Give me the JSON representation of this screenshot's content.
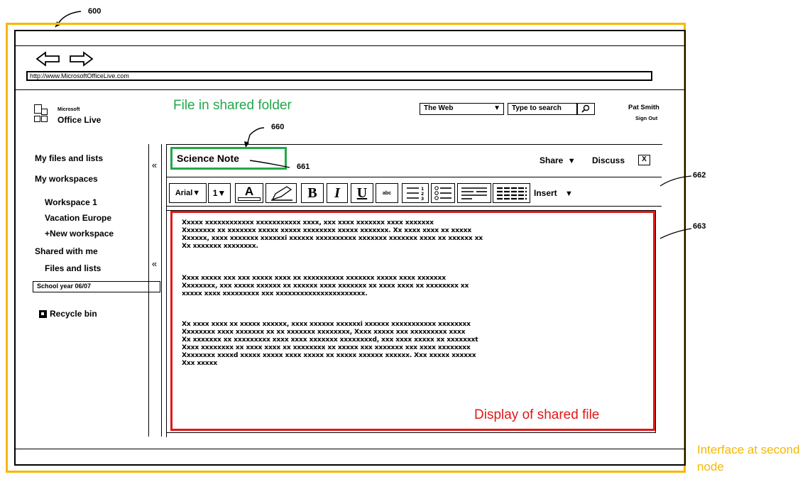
{
  "figure": {
    "ref_600": "600",
    "ref_660": "660",
    "ref_661": "661",
    "ref_662": "662",
    "ref_663": "663"
  },
  "browser": {
    "url": "http://www.MicrosoftOfficeLive.com",
    "back_icon": "left-arrow",
    "forward_icon": "right-arrow"
  },
  "header": {
    "logo_small": "Microsoft",
    "logo_main": "Office Live",
    "search_scope": "The Web",
    "search_placeholder": "Type to search",
    "user_name": "Pat Smith",
    "sign_out": "Sign Out"
  },
  "sidebar": {
    "my_files": "My files and lists",
    "my_workspaces": "My workspaces",
    "workspace_1": "Workspace 1",
    "vacation_europe": "Vacation Europe",
    "new_workspace": "+New workspace",
    "shared_with_me": "Shared with me",
    "files_and_lists": "Files and lists",
    "school_year": "School year 06/07",
    "recycle_bin": "Recycle bin"
  },
  "document": {
    "title": "Science Note",
    "share": "Share",
    "discuss": "Discuss",
    "close": "X"
  },
  "toolbar": {
    "font": "Arial",
    "size": "1",
    "font_color": "A",
    "bold": "B",
    "italic": "I",
    "underline": "U",
    "strike": "abc",
    "insert": "Insert"
  },
  "content": {
    "para1": [
      "Xxxxx xxxxxxxxxxxx xxxxxxxxxxx xxxx, xxx xxxx xxxxxxx xxxx xxxxxxx",
      "Xxxxxxxx xx xxxxxxx xxxxx xxxxx xxxxxxxx xxxxx xxxxxxx.  Xx xxxx xxxx xx xxxxx",
      "Xxxxxx, xxxx xxxxxxx xxxxxxi xxxxxx xxxxxxxxxx xxxxxxx xxxxxxx xxxx xx xxxxxx xx",
      "Xx xxxxxxx xxxxxxxx."
    ],
    "para2": [
      "Xxxx xxxxx xxx xxx xxxxx xxxx xx xxxxxxxxxx xxxxxxx xxxxx xxxx xxxxxxx",
      "Xxxxxxxx, xxx xxxxx xxxxxx xx xxxxxx xxxx xxxxxxx xx xxxx xxxx xx xxxxxxxx xx",
      "xxxxx xxxx xxxxxxxxx xxx xxxxxxxxxxxxxxxxxxxxxx."
    ],
    "para3": [
      "Xx xxxx xxxx xx xxxxx xxxxxx, xxxx xxxxxx xxxxxxi xxxxxx xxxxxxxxxxx xxxxxxxx",
      "Xxxxxxxx xxxx xxxxxxx xx xx xxxxxxx xxxxxxxx, Xxxx xxxxx xxx xxxxxxxxx xxxx",
      "Xx xxxxxxx xx xxxxxxxxx xxxx xxxx xxxxxxx xxxxxxxxd, xxx xxxx xxxxx xx xxxxxxxt",
      "Xxxx xxxxxxxx xx xxxx xxxx xx xxxxxxxx xx xxxxx xxx xxxxxxx xxx xxxx xxxxxxxx",
      "Xxxxxxxx xxxxd xxxxx xxxxx xxxx xxxxx xx xxxxx xxxxxx xxxxxx.  Xxx xxxxx xxxxxx",
      "Xxx xxxxx"
    ]
  },
  "annotations": {
    "shared_folder": "File in shared folder",
    "display": "Display of shared file",
    "interface": "Interface at second node"
  },
  "colors": {
    "green": "#22a84a",
    "red": "#e01818",
    "orange": "#f5b800"
  }
}
